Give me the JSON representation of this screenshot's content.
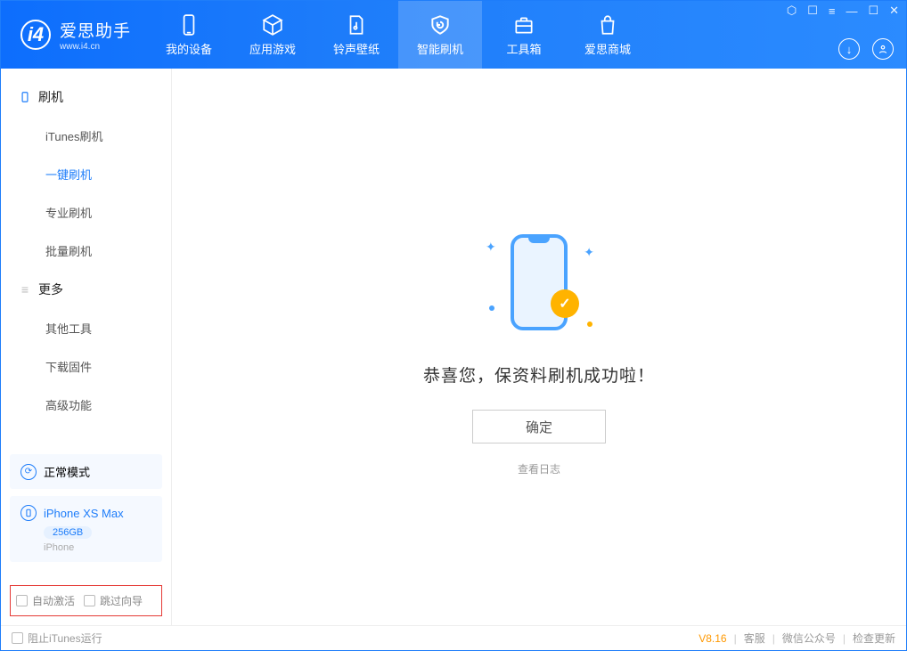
{
  "app": {
    "name": "爱思助手",
    "site": "www.i4.cn"
  },
  "tabs": [
    {
      "id": "device",
      "label": "我的设备"
    },
    {
      "id": "apps",
      "label": "应用游戏"
    },
    {
      "id": "media",
      "label": "铃声壁纸"
    },
    {
      "id": "flash",
      "label": "智能刷机"
    },
    {
      "id": "tools",
      "label": "工具箱"
    },
    {
      "id": "store",
      "label": "爱思商城"
    }
  ],
  "sidebar": {
    "group1": {
      "title": "刷机",
      "items": [
        {
          "id": "itunes",
          "label": "iTunes刷机"
        },
        {
          "id": "oneclick",
          "label": "一键刷机"
        },
        {
          "id": "pro",
          "label": "专业刷机"
        },
        {
          "id": "batch",
          "label": "批量刷机"
        }
      ]
    },
    "group2": {
      "title": "更多",
      "items": [
        {
          "id": "other",
          "label": "其他工具"
        },
        {
          "id": "firmware",
          "label": "下载固件"
        },
        {
          "id": "advanced",
          "label": "高级功能"
        }
      ]
    }
  },
  "device": {
    "mode_label": "正常模式",
    "name": "iPhone XS Max",
    "storage": "256GB",
    "type": "iPhone"
  },
  "options": {
    "auto_activate": "自动激活",
    "skip_guide": "跳过向导"
  },
  "result": {
    "message": "恭喜您，保资料刷机成功啦！",
    "ok": "确定",
    "view_log": "查看日志"
  },
  "footer": {
    "block_itunes": "阻止iTunes运行",
    "version": "V8.16",
    "support": "客服",
    "wechat": "微信公众号",
    "update": "检查更新"
  }
}
